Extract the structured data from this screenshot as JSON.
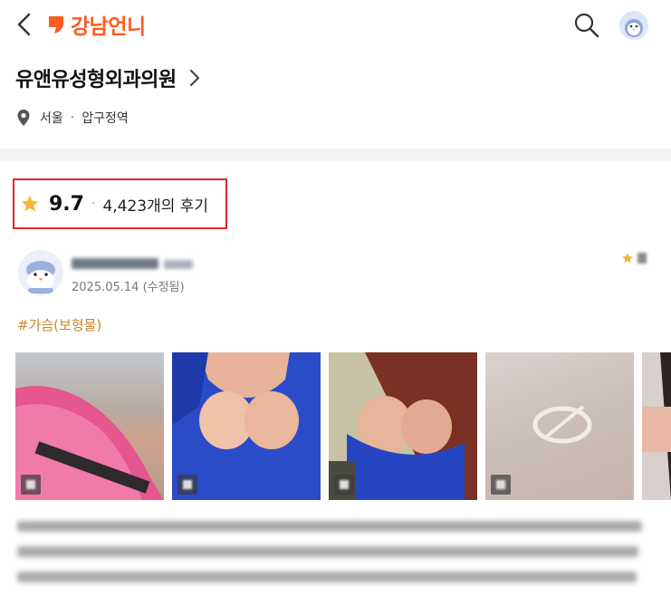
{
  "app": {
    "logo_text": "강남언니",
    "brand_color": "#ff5a1f"
  },
  "clinic": {
    "name": "유앤유성형외과의원",
    "location_city": "서울",
    "location_separator": "·",
    "location_area": "압구정역"
  },
  "rating": {
    "score": "9.7",
    "separator": "·",
    "review_count": "4,423개의 후기",
    "highlight_color": "#e32626"
  },
  "review": {
    "date": "2025.05.14 (수정됨)",
    "tag": "#가슴(보형물)",
    "photo_count": 5
  },
  "icons": {
    "back": "chevron-left-icon",
    "search": "search-icon",
    "profile": "penguin-avatar-icon",
    "location": "map-pin-icon",
    "rating": "star-icon",
    "clinic_link": "chevron-right-icon"
  }
}
